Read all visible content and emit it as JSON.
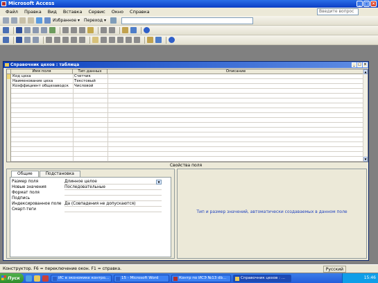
{
  "app": {
    "title": "Microsoft Access"
  },
  "menu": [
    "Файл",
    "Правка",
    "Вид",
    "Вставка",
    "Сервис",
    "Окно",
    "Справка"
  ],
  "help_placeholder": "Введите вопрос",
  "nav_toolbar": {
    "favorites": "Избранное ▾",
    "go": "Переход ▾"
  },
  "table_window": {
    "title": "Справочник цехов : таблица",
    "columns": [
      "Имя поля",
      "Тип данных",
      "Описание"
    ],
    "rows": [
      {
        "name": "Код цеха",
        "type": "Счетчик"
      },
      {
        "name": "Наименование цеха",
        "type": "Текстовый"
      },
      {
        "name": "Коэффициент общезаводск",
        "type": "Числовой"
      }
    ]
  },
  "properties": {
    "header": "Свойства поля",
    "tabs": [
      "Общие",
      "Подстановка"
    ],
    "rows": [
      {
        "label": "Размер поля",
        "value": "Длинное целое"
      },
      {
        "label": "Новые значения",
        "value": "Последовательные"
      },
      {
        "label": "Формат поля",
        "value": ""
      },
      {
        "label": "Подпись",
        "value": ""
      },
      {
        "label": "Индексированное поле",
        "value": "Да (Совпадения не допускаются)"
      },
      {
        "label": "Смарт-теги",
        "value": ""
      }
    ],
    "hint": "Тип и размер значений, автоматически создаваемых в данном поле"
  },
  "status": {
    "text": "Конструктор.  F6 = переключение окон.  F1 = справка.",
    "lang": "Русский"
  },
  "taskbar": {
    "start": "Пуск",
    "tasks": [
      "ИС в экономике контро...",
      "15 - Microsoft Word",
      "Контр по ИСЭ №13  db...",
      "Справочник цехов : ..."
    ],
    "time": "15:46"
  },
  "colors": {
    "accent": "#0a3fbe",
    "taskbar": "#245edb",
    "hint": "#1c3fbf"
  }
}
